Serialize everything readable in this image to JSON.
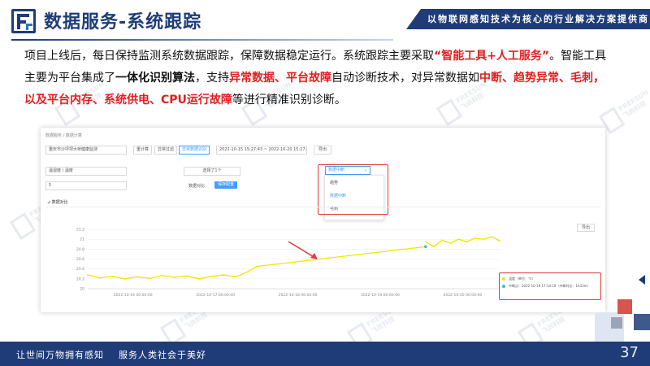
{
  "header": {
    "title": "数据服务-系统跟踪",
    "slogan": "以物联网感知技术为核心的行业解决方案提供商"
  },
  "watermark": {
    "line1": "FREESUN",
    "line2": "飞尚科技"
  },
  "paragraph": {
    "p1": "项目上线后，每日保持监测系统数据跟踪，保障数据稳定运行。系统跟踪主要采取",
    "p2": "“智能工具+人工服务”",
    "p3": "。智能工具主要为平台集成了",
    "p4": "一体化识别算法",
    "p5": "，支持",
    "p6": "异常数据、平台故障",
    "p7": "自动诊断技术，对异常数据如",
    "p8": "中断、趋势异常、毛刺，以及平台内存、系统供电、CPU运行故障",
    "p9": "等进行精准识别诊断。"
  },
  "app": {
    "breadcrumb": "数据服务 / 数据计算",
    "point_select": "重庆市沙坪坝大桥健康监测",
    "tabs": [
      "重计算",
      "异常过滤",
      "异常数据识别"
    ],
    "date_range": "2022-10-15 15:27:43 ~ 2022-10-20 15:27:43",
    "export_label": "导出",
    "metric_select": "温湿度 / 温度",
    "selected_count": "选择了1个",
    "mode_select": "数据中断",
    "dropdown_options": [
      "趋势",
      "数据中断",
      "毛刺"
    ],
    "threshold_value": "5",
    "compare_link": "数据对比",
    "save_button": "保存配置",
    "section_title": "数据对比",
    "export2_label": "导出",
    "legend": {
      "series1": "温度（单位：℃）",
      "series2": "中断点：2022-10-19 17:14:19（中断时长：1h33m）"
    }
  },
  "chart_data": {
    "type": "line",
    "title": "",
    "xlabel": "",
    "ylabel": "",
    "ylim": [
      20,
      21.2
    ],
    "y_ticks": [
      "21.2",
      "21",
      "20.8",
      "20.6",
      "20.4",
      "20.2",
      "20"
    ],
    "x_ticks": [
      "2022-10-16 00:00:00",
      "2022-10-17 00:00:00",
      "2022-10-18 00:00:00",
      "2022-10-19 00:00:00",
      "2022-10-20 00:00:00"
    ],
    "x_range_days": [
      0,
      5.0
    ],
    "series": [
      {
        "name": "温度（单位：℃）",
        "color": "#f5e300",
        "segments": [
          {
            "x": [
              0.0,
              0.15,
              0.3,
              0.45,
              0.6,
              0.75,
              0.9,
              1.05,
              1.2,
              1.35,
              1.5,
              1.65,
              1.8,
              1.95,
              2.05
            ],
            "y": [
              20.28,
              20.22,
              20.25,
              20.2,
              20.24,
              20.21,
              20.27,
              20.23,
              20.26,
              20.2,
              20.25,
              20.28,
              20.24,
              20.35,
              20.45
            ]
          },
          {
            "x": [
              2.05,
              4.1
            ],
            "y": [
              20.45,
              20.85
            ]
          },
          {
            "x": [
              4.1,
              4.2,
              4.3,
              4.4,
              4.5,
              4.6,
              4.7,
              4.8,
              4.9,
              5.0
            ],
            "y": [
              20.95,
              20.85,
              20.98,
              20.92,
              21.0,
              20.95,
              21.02,
              21.0,
              21.05,
              20.97
            ]
          }
        ]
      }
    ],
    "interruption_point": {
      "date": "2022-10-19 17:14:19",
      "y": 20.85,
      "color": "#3fb8e8"
    },
    "grid": true,
    "legend_position": "bottom-right"
  },
  "footer": {
    "slogan_left": "让世间万物拥有感知",
    "slogan_right": "服务人类社会于美好",
    "page_number": "37"
  },
  "colors": {
    "brand": "#1f3c78",
    "highlight_red": "#e02020",
    "series": "#f5e300",
    "primary_button": "#409eff"
  }
}
